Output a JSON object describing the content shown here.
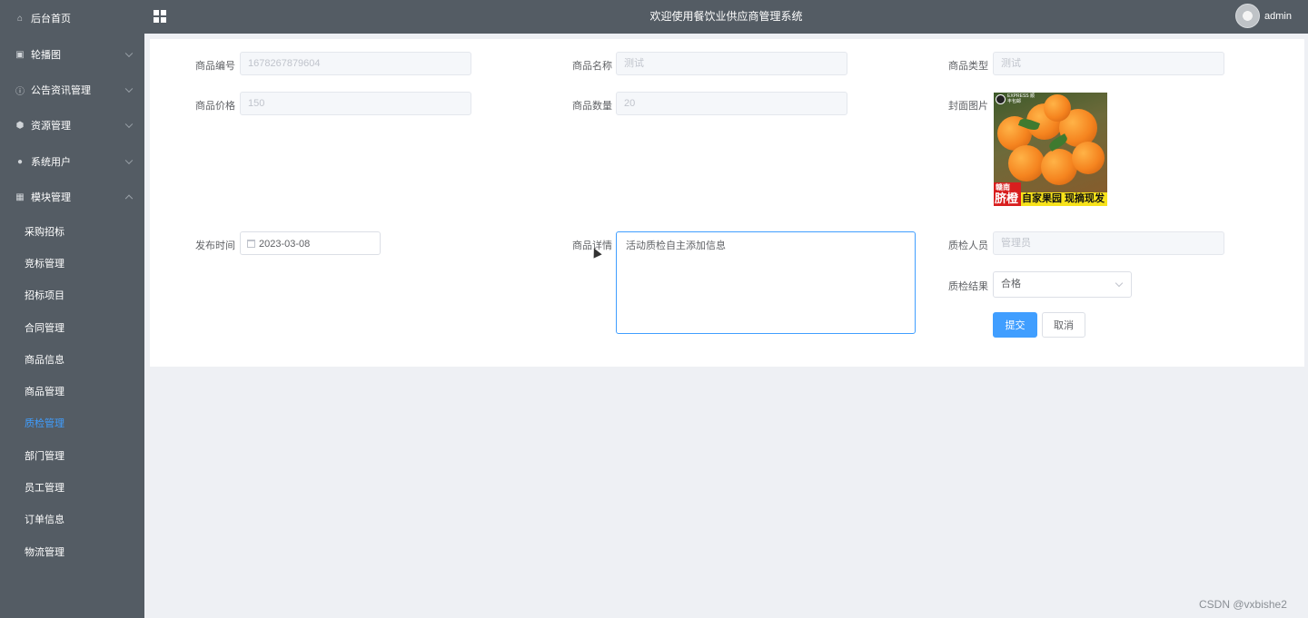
{
  "sidebar": {
    "items": [
      {
        "label": "后台首页",
        "icon": "home-icon"
      },
      {
        "label": "轮播图",
        "icon": "picture-icon"
      },
      {
        "label": "公告资讯管理",
        "icon": "info-icon"
      },
      {
        "label": "资源管理",
        "icon": "shield-icon"
      },
      {
        "label": "系统用户",
        "icon": "user-icon"
      },
      {
        "label": "模块管理",
        "icon": "grid-icon"
      }
    ],
    "sub_items": [
      {
        "label": "采购招标"
      },
      {
        "label": "竞标管理"
      },
      {
        "label": "招标项目"
      },
      {
        "label": "合同管理"
      },
      {
        "label": "商品信息"
      },
      {
        "label": "商品管理"
      },
      {
        "label": "质检管理"
      },
      {
        "label": "部门管理"
      },
      {
        "label": "员工管理"
      },
      {
        "label": "订单信息"
      },
      {
        "label": "物流管理"
      }
    ],
    "active_sub": "质检管理"
  },
  "header": {
    "title": "欢迎使用餐饮业供应商管理系统",
    "username": "admin"
  },
  "form": {
    "product_code": {
      "label": "商品编号",
      "value": "1678267879604"
    },
    "product_name": {
      "label": "商品名称",
      "value": "测试"
    },
    "product_type": {
      "label": "商品类型",
      "value": "测试"
    },
    "product_price": {
      "label": "商品价格",
      "value": "150"
    },
    "product_qty": {
      "label": "商品数量",
      "value": "20"
    },
    "cover_image": {
      "label": "封面图片",
      "badge_text": "EXPRESS 顺丰包邮",
      "banner_small": "赣南",
      "banner_big": "脐橙",
      "banner_text": "自家果园 现摘现发"
    },
    "publish_time": {
      "label": "发布时间",
      "value": "2023-03-08"
    },
    "product_detail": {
      "label": "商品详情",
      "value": "活动质检自主添加信息"
    },
    "inspector": {
      "label": "质检人员",
      "value": "管理员"
    },
    "inspect_result": {
      "label": "质检结果",
      "value": "合格"
    }
  },
  "buttons": {
    "submit": "提交",
    "cancel": "取消"
  },
  "watermark": "CSDN @vxbishe2",
  "colors": {
    "sidebar_bg": "#545c64",
    "accent": "#409eff",
    "page_bg": "#eef0f4"
  }
}
